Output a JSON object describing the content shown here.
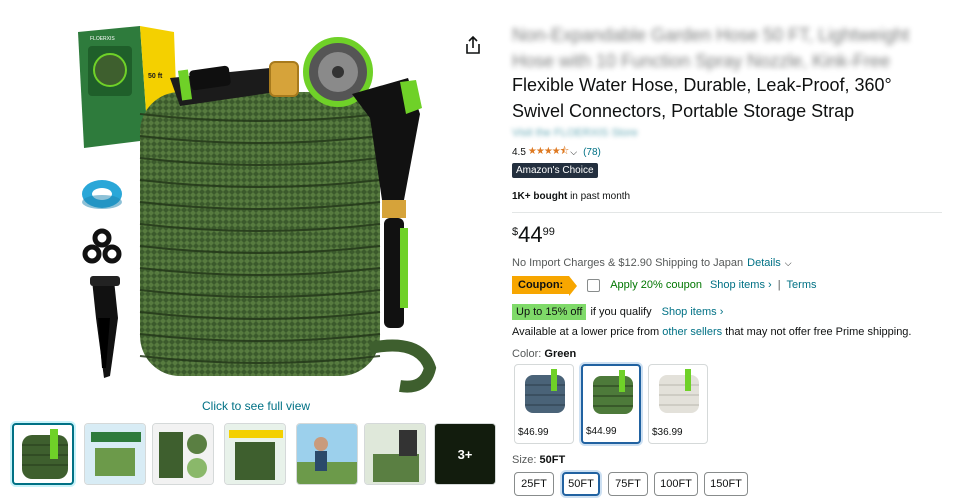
{
  "product": {
    "title_blurred": "Non-Expandable Garden Hose 50 FT, Lightweight Hose with 10 Function Spray Nozzle, Kink-Free",
    "title": "Flexible Water Hose, Durable, Leak-Proof, 360° Swivel Connectors, Portable Storage Strap",
    "store_blurred": "Visit the FLOERXIS Store",
    "rating": "4.5",
    "rating_count": "(78)",
    "badge": "Amazon's Choice",
    "bought_bold": "1K+ bought",
    "bought_rest": "in past month"
  },
  "media": {
    "see_full": "Click to see full view",
    "more_count": "3+",
    "box_brand": "FLOERXIS",
    "box_size": "50 ft"
  },
  "price": {
    "currency": "$",
    "whole": "44",
    "fraction": "99"
  },
  "shipping": {
    "text": "No Import Charges & $12.90 Shipping to Japan",
    "details": "Details"
  },
  "coupon": {
    "tag": "Coupon:",
    "apply": "Apply 20% coupon",
    "shop": "Shop items ›",
    "terms": "Terms"
  },
  "discount": {
    "badge": "Up to 15% off",
    "qualify": "if you qualify",
    "shop": "Shop items ›"
  },
  "offers": {
    "prefix": "Available at a lower price from",
    "link": "other sellers",
    "suffix": "that may not offer free Prime shipping."
  },
  "color": {
    "label": "Color:",
    "selected": "Green",
    "options": [
      {
        "price": "$46.99",
        "hose_color": "#4a6378"
      },
      {
        "price": "$44.99",
        "hose_color": "#4d7a3a"
      },
      {
        "price": "$36.99",
        "hose_color": "#e3e1da"
      }
    ]
  },
  "size": {
    "label": "Size:",
    "selected": "50FT",
    "options": [
      "25FT",
      "50FT",
      "75FT",
      "100FT",
      "150FT"
    ]
  },
  "colors": {
    "link": "#007185",
    "star": "#de7921",
    "coupon": "#f7a600",
    "discount": "#7fda69",
    "selected": "#2162a1",
    "hose_green": "#3e5f2e",
    "nozzle_green": "#6fd128"
  }
}
